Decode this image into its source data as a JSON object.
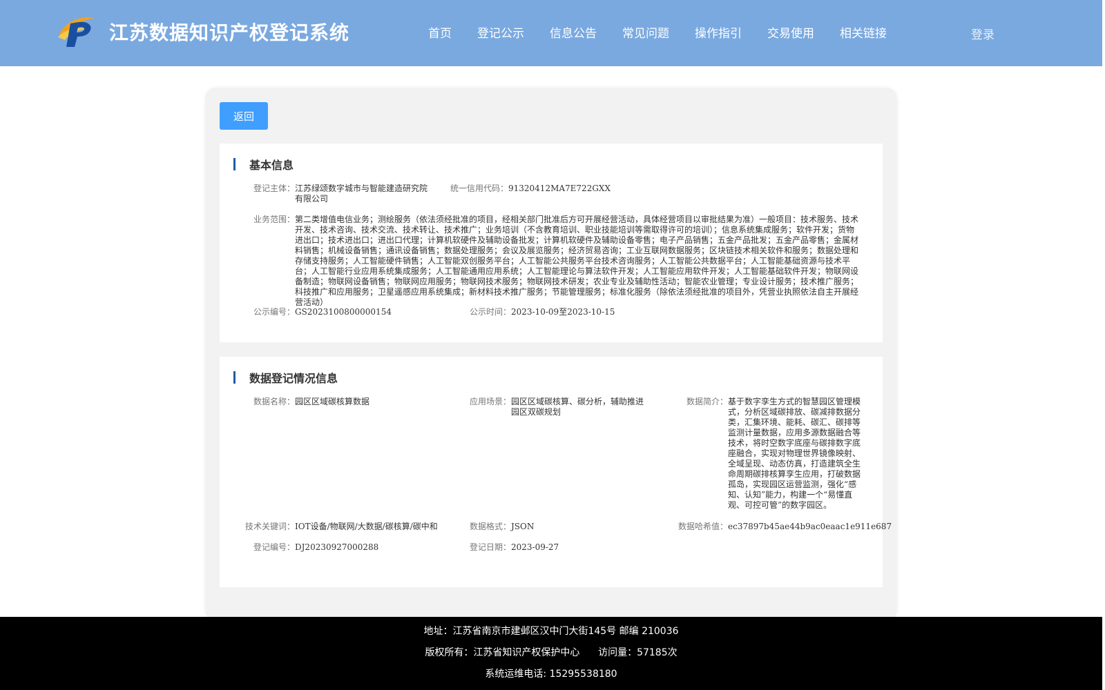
{
  "header": {
    "site_title": "江苏数据知识产权登记系统",
    "nav": [
      "首页",
      "登记公示",
      "信息公告",
      "常见问题",
      "操作指引",
      "交易使用",
      "相关链接"
    ],
    "login": "登录"
  },
  "back_button": "返回",
  "basic_info": {
    "section_title": "基本信息",
    "registrant_label": "登记主体：",
    "registrant_value": "江苏绿颂数字城市与智能建造研究院有限公司",
    "credit_code_label": "统一信用代码：",
    "credit_code_value": "91320412MA7E722GXX",
    "scope_label": "业务范围：",
    "scope_value": "第二类增值电信业务；测绘服务（依法须经批准的项目，经相关部门批准后方可开展经营活动，具体经营项目以审批结果为准）一般项目：技术服务、技术开发、技术咨询、技术交流、技术转让、技术推广；业务培训（不含教育培训、职业技能培训等需取得许可的培训）；信息系统集成服务；软件开发；货物进出口；技术进出口；进出口代理；计算机软硬件及辅助设备批发；计算机软硬件及辅助设备零售；电子产品销售；五金产品批发；五金产品零售；金属材料销售；机械设备销售；通讯设备销售；数据处理服务；会议及展览服务；经济贸易咨询；工业互联网数据服务；区块链技术相关软件和服务；数据处理和存储支持服务；人工智能硬件销售；人工智能双创服务平台；人工智能公共服务平台技术咨询服务；人工智能公共数据平台；人工智能基础资源与技术平台；人工智能行业应用系统集成服务；人工智能通用应用系统；人工智能理论与算法软件开发；人工智能应用软件开发；人工智能基础软件开发；物联网设备制造；物联网设备销售；物联网应用服务；物联网技术服务；物联网技术研发；农业专业及辅助性活动；智能农业管理；专业设计服务；技术推广服务；科技推广和应用服务；卫星遥感应用系统集成；新材料技术推广服务；节能管理服务；标准化服务（除依法须经批准的项目外，凭营业执照依法自主开展经营活动）",
    "pub_no_label": "公示编号：",
    "pub_no_value": "GS2023100800000154",
    "pub_time_label": "公示时间：",
    "pub_time_value": "2023-10-09至2023-10-15"
  },
  "data_info": {
    "section_title": "数据登记情况信息",
    "data_name_label": "数据名称：",
    "data_name_value": "园区区域碳核算数据",
    "scene_label": "应用场景：",
    "scene_value": "园区区域碳核算、碳分析，辅助推进园区双碳规划",
    "intro_label": "数据简介：",
    "intro_value": "基于数字孪生方式的智慧园区管理模式，分析区域碳排放、碳减排数据分类，汇集环境、能耗、碳汇、碳排等监测计量数据，应用多源数据融合等技术，将时空数字底座与碳排数字底座融合，实现对物理世界镜像映射、全域呈现、动态仿真，打造建筑全生命周期碳排核算孪生应用，打破数据孤岛，实现园区运营监测，强化“感知、认知”能力，构建一个“易懂直观、可控可管”的数字园区。",
    "keywords_label": "技术关键词：",
    "keywords_value": "IOT设备/物联网/大数据/碳核算/碳中和",
    "format_label": "数据格式：",
    "format_value": "JSON",
    "hash_label": "数据哈希值：",
    "hash_value": "ec37897b45ae44b9ac0eaac1e911e687",
    "reg_no_label": "登记编号：",
    "reg_no_value": "DJ20230927000288",
    "reg_date_label": "登记日期：",
    "reg_date_value": "2023-09-27"
  },
  "footer": {
    "address": "地址：江苏省南京市建邺区汉中门大街145号 邮编 210036",
    "copyright": "版权所有：江苏省知识产权保护中心      访问量：57185次",
    "phone": "系统运维电话: 15295538180"
  },
  "colors": {
    "header_bg": "#7aa9e0",
    "button_blue": "#409eff",
    "section_bar": "#1e5aa8",
    "footer_bg": "#000000"
  }
}
